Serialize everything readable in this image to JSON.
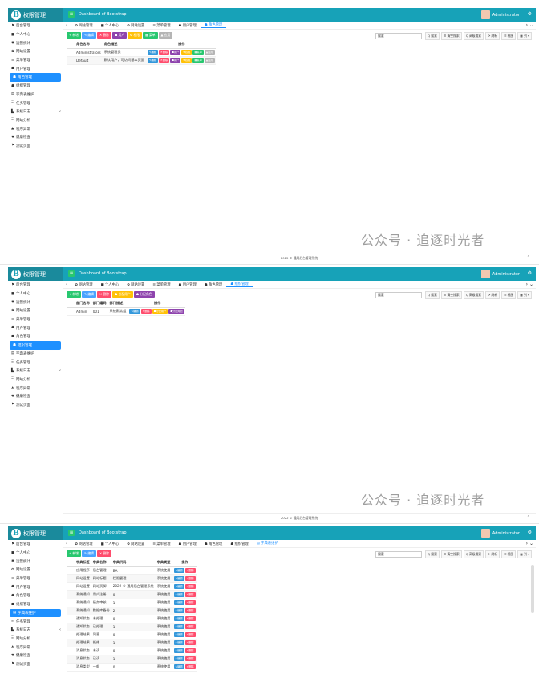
{
  "app": {
    "logo": "B",
    "title": "权限管理",
    "breadcrumb": "Dashboard of Bootstrap",
    "user": "Administrator"
  },
  "menu": [
    {
      "icon": "⚑",
      "label": "后台管理"
    },
    {
      "icon": "■",
      "label": "个人中心"
    },
    {
      "icon": "◉",
      "label": "运营统计"
    },
    {
      "icon": "✿",
      "label": "网站设置"
    },
    {
      "icon": "≡",
      "label": "菜单管理"
    },
    {
      "icon": "☗",
      "label": "用户管理"
    },
    {
      "icon": "☗",
      "label": "角色管理"
    },
    {
      "icon": "☗",
      "label": "组织管理"
    },
    {
      "icon": "▤",
      "label": "字典表维护"
    },
    {
      "icon": "☷",
      "label": "任务管理"
    },
    {
      "icon": "▙",
      "label": "系统日志",
      "arrow": "‹"
    },
    {
      "icon": "☷",
      "label": "网站分析"
    },
    {
      "icon": "▲",
      "label": "程序异常"
    },
    {
      "icon": "♥",
      "label": "健康检查"
    },
    {
      "icon": "⚑",
      "label": "测试页面"
    }
  ],
  "p1": {
    "tabs": [
      "‹",
      "✿ 网站管理",
      "■ 个人中心",
      "✿ 网站设置",
      "≡ 菜单管理",
      "☗ 用户管理",
      "☗ 角色管理"
    ],
    "buttons": [
      {
        "t": "+ 新增",
        "c": "g"
      },
      {
        "t": "✎ 编辑",
        "c": "b"
      },
      {
        "t": "✕ 删除",
        "c": "r"
      },
      {
        "t": "☗ 用户",
        "c": "p"
      },
      {
        "t": "✿ 权限",
        "c": "y"
      },
      {
        "t": "▦ 菜单",
        "c": "g"
      },
      {
        "t": "▲ 应用",
        "c": "gy"
      }
    ],
    "search": "搜索",
    "tools": [
      "Q 搜索",
      "☰ 清空搜索",
      "Q 高级搜索",
      "⟳ 刷新",
      "☷ 视图",
      "▦ 列 ▾"
    ],
    "cols": [
      "角色名称",
      "角色描述",
      "操作"
    ],
    "rows": [
      [
        "Administrators",
        "系统管理员"
      ],
      [
        "Default",
        "默认用户，可访问基本页面"
      ]
    ],
    "ops": [
      {
        "t": "✎编辑",
        "c": "bl"
      },
      {
        "t": "✕删除",
        "c": "r"
      },
      {
        "t": "☗用户",
        "c": "p"
      },
      {
        "t": "✿权限",
        "c": "y"
      },
      {
        "t": "▦菜单",
        "c": "g"
      },
      {
        "t": "▲应用",
        "c": "gy"
      }
    ]
  },
  "p2": {
    "tabs": [
      "‹",
      "✿ 网站管理",
      "■ 个人中心",
      "✿ 网站设置",
      "≡ 菜单管理",
      "☗ 用户管理",
      "☗ 角色管理",
      "☗ 组织管理"
    ],
    "buttons": [
      {
        "t": "+ 新增",
        "c": "g"
      },
      {
        "t": "✎ 编辑",
        "c": "b"
      },
      {
        "t": "✕ 删除",
        "c": "r"
      },
      {
        "t": "☗ 分配用户",
        "c": "y"
      },
      {
        "t": "☗ 分配角色",
        "c": "p"
      }
    ],
    "cols": [
      "部门名称",
      "部门编码",
      "部门描述",
      "操作"
    ],
    "rows": [
      [
        "Admin",
        "001",
        "系统默认组"
      ]
    ],
    "ops": [
      {
        "t": "✎编辑",
        "c": "bl"
      },
      {
        "t": "✕删除",
        "c": "r"
      },
      {
        "t": "☗分配用户",
        "c": "y"
      },
      {
        "t": "☗分配角色",
        "c": "p"
      }
    ]
  },
  "p3": {
    "tabs": [
      "‹",
      "✿ 网站管理",
      "■ 个人中心",
      "✿ 网站设置",
      "≡ 菜单管理",
      "☗ 用户管理",
      "☗ 角色管理",
      "☗ 组织管理",
      "▤ 字典表维护"
    ],
    "buttons": [
      {
        "t": "+ 新增",
        "c": "g"
      },
      {
        "t": "✎ 编辑",
        "c": "b"
      },
      {
        "t": "✕ 删除",
        "c": "r"
      }
    ],
    "cols": [
      "字典标签",
      "字典名称",
      "字典代码",
      "字典类型",
      "操作"
    ],
    "rows": [
      [
        "应用程序",
        "后台管理",
        "BA",
        "系统使用"
      ],
      [
        "网站设置",
        "网站标题",
        "权限管理",
        "系统使用"
      ],
      [
        "网站设置",
        "网站页脚",
        "2022 © 通用后台管理系统",
        "系统使用"
      ],
      [
        "系统通知",
        "用户注册",
        "0",
        "系统使用"
      ],
      [
        "系统通知",
        "债务审核",
        "1",
        "系统使用"
      ],
      [
        "系统通知",
        "数据库备份",
        "2",
        "系统使用"
      ],
      [
        "通知状态",
        "未处理",
        "0",
        "系统使用"
      ],
      [
        "通知状态",
        "已处理",
        "1",
        "系统使用"
      ],
      [
        "处理结果",
        "同意",
        "0",
        "系统使用"
      ],
      [
        "处理结果",
        "拒绝",
        "1",
        "系统使用"
      ],
      [
        "消息状态",
        "未读",
        "0",
        "系统使用"
      ],
      [
        "消息状态",
        "已读",
        "1",
        "系统使用"
      ],
      [
        "消息类型",
        "一般",
        "0",
        "系统使用"
      ]
    ],
    "ops": [
      {
        "t": "✎编辑",
        "c": "bl"
      },
      {
        "t": "✕删除",
        "c": "r"
      }
    ]
  },
  "footer": "2022 © 通用后台管理系统",
  "watermark": "公众号 · 追逐时光者"
}
